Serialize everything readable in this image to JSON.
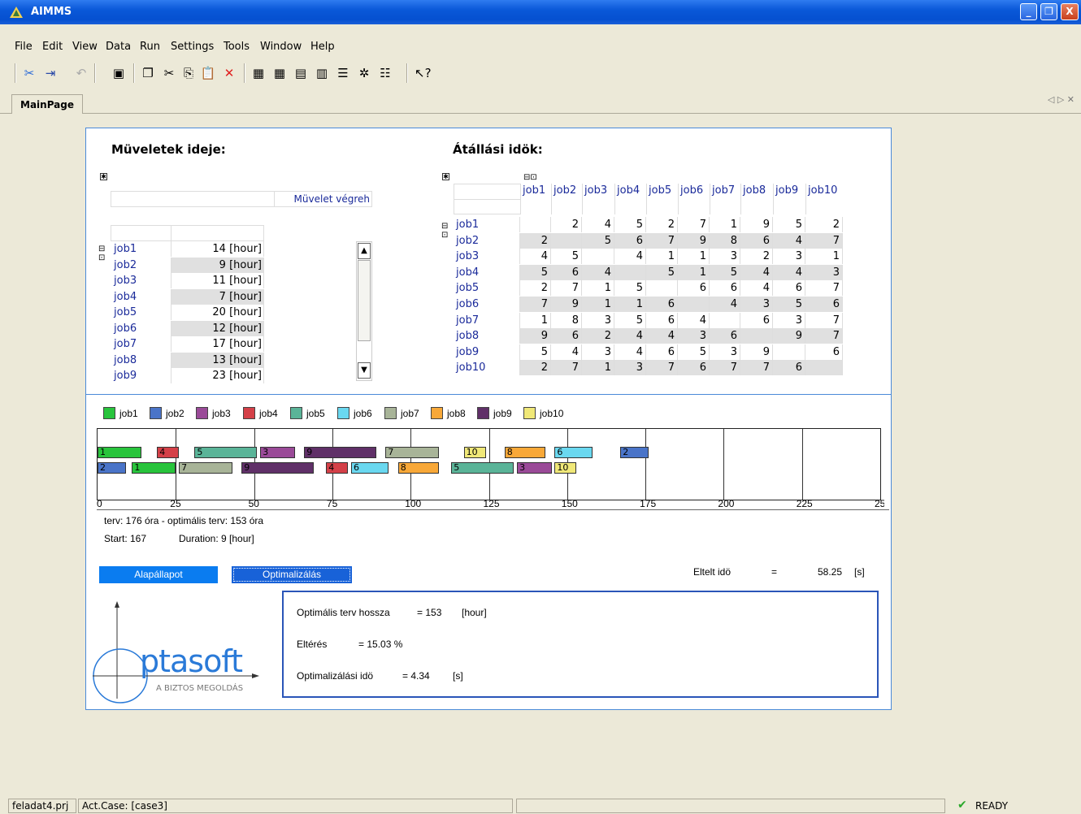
{
  "window": {
    "title": "AIMMS"
  },
  "menu": [
    "File",
    "Edit",
    "View",
    "Data",
    "Run",
    "Settings",
    "Tools",
    "Window",
    "Help"
  ],
  "tabs": {
    "main": "MainPage"
  },
  "section1": {
    "title": "Müveletek ideje:",
    "column_header": "Müvelet végreh",
    "rows": [
      {
        "job": "job1",
        "value": "14 [hour]"
      },
      {
        "job": "job2",
        "value": "9 [hour]"
      },
      {
        "job": "job3",
        "value": "11 [hour]"
      },
      {
        "job": "job4",
        "value": "7 [hour]"
      },
      {
        "job": "job5",
        "value": "20 [hour]"
      },
      {
        "job": "job6",
        "value": "12 [hour]"
      },
      {
        "job": "job7",
        "value": "17 [hour]"
      },
      {
        "job": "job8",
        "value": "13 [hour]"
      },
      {
        "job": "job9",
        "value": "23 [hour]"
      }
    ]
  },
  "section2": {
    "title": "Átállási idök:",
    "columns": [
      "job1",
      "job2",
      "job3",
      "job4",
      "job5",
      "job6",
      "job7",
      "job8",
      "job9",
      "job10"
    ],
    "rows": [
      {
        "job": "job1",
        "values": [
          "",
          "2",
          "4",
          "5",
          "2",
          "7",
          "1",
          "9",
          "5",
          "2"
        ]
      },
      {
        "job": "job2",
        "values": [
          "2",
          "",
          "5",
          "6",
          "7",
          "9",
          "8",
          "6",
          "4",
          "7"
        ]
      },
      {
        "job": "job3",
        "values": [
          "4",
          "5",
          "",
          "4",
          "1",
          "1",
          "3",
          "2",
          "3",
          "1"
        ]
      },
      {
        "job": "job4",
        "values": [
          "5",
          "6",
          "4",
          "",
          "5",
          "1",
          "5",
          "4",
          "4",
          "3"
        ]
      },
      {
        "job": "job5",
        "values": [
          "2",
          "7",
          "1",
          "5",
          "",
          "6",
          "6",
          "4",
          "6",
          "7"
        ]
      },
      {
        "job": "job6",
        "values": [
          "7",
          "9",
          "1",
          "1",
          "6",
          "",
          "4",
          "3",
          "5",
          "6"
        ]
      },
      {
        "job": "job7",
        "values": [
          "1",
          "8",
          "3",
          "5",
          "6",
          "4",
          "",
          "6",
          "3",
          "7"
        ]
      },
      {
        "job": "job8",
        "values": [
          "9",
          "6",
          "2",
          "4",
          "4",
          "3",
          "6",
          "",
          "9",
          "7"
        ]
      },
      {
        "job": "job9",
        "values": [
          "5",
          "4",
          "3",
          "4",
          "6",
          "5",
          "3",
          "9",
          "",
          "6"
        ]
      },
      {
        "job": "job10",
        "values": [
          "2",
          "7",
          "1",
          "3",
          "7",
          "6",
          "7",
          "7",
          "6",
          ""
        ]
      }
    ]
  },
  "gantt": {
    "legend": [
      {
        "name": "job1",
        "color": "#28c43c"
      },
      {
        "name": "job2",
        "color": "#4a74c8"
      },
      {
        "name": "job3",
        "color": "#9a4a98"
      },
      {
        "name": "job4",
        "color": "#d44048"
      },
      {
        "name": "job5",
        "color": "#5ab498"
      },
      {
        "name": "job6",
        "color": "#6ad8f0"
      },
      {
        "name": "job7",
        "color": "#a8b498"
      },
      {
        "name": "job8",
        "color": "#f8a838"
      },
      {
        "name": "job9",
        "color": "#603068"
      },
      {
        "name": "job10",
        "color": "#f0e878"
      }
    ],
    "axis": {
      "min": 0,
      "max": 250,
      "ticks": [
        "0",
        "25",
        "50",
        "75",
        "100",
        "125",
        "150",
        "175",
        "200",
        "225",
        "250"
      ]
    },
    "machine1": [
      {
        "label": "1",
        "job": 1,
        "start": 0,
        "end": 14
      },
      {
        "label": "4",
        "job": 4,
        "start": 19,
        "end": 26
      },
      {
        "label": "5",
        "job": 5,
        "start": 31,
        "end": 51
      },
      {
        "label": "3",
        "job": 3,
        "start": 52,
        "end": 63
      },
      {
        "label": "9",
        "job": 9,
        "start": 66,
        "end": 89
      },
      {
        "label": "7",
        "job": 7,
        "start": 92,
        "end": 109
      },
      {
        "label": "10",
        "job": 10,
        "start": 117,
        "end": 124
      },
      {
        "label": "8",
        "job": 8,
        "start": 130,
        "end": 143
      },
      {
        "label": "6",
        "job": 6,
        "start": 146,
        "end": 158
      },
      {
        "label": "2",
        "job": 2,
        "start": 167,
        "end": 176
      }
    ],
    "machine2": [
      {
        "label": "2",
        "job": 2,
        "start": 0,
        "end": 9
      },
      {
        "label": "1",
        "job": 1,
        "start": 11,
        "end": 25
      },
      {
        "label": "7",
        "job": 7,
        "start": 26,
        "end": 43
      },
      {
        "label": "9",
        "job": 9,
        "start": 46,
        "end": 69
      },
      {
        "label": "4",
        "job": 4,
        "start": 73,
        "end": 80
      },
      {
        "label": "6",
        "job": 6,
        "start": 81,
        "end": 93
      },
      {
        "label": "8",
        "job": 8,
        "start": 96,
        "end": 109
      },
      {
        "label": "5",
        "job": 5,
        "start": 113,
        "end": 133
      },
      {
        "label": "3",
        "job": 3,
        "start": 134,
        "end": 145
      },
      {
        "label": "10",
        "job": 10,
        "start": 146,
        "end": 153
      }
    ]
  },
  "info": {
    "plan": "terv: 176 óra  -  optimális terv: 153 óra",
    "start": "Start: 167",
    "duration": "Duration: 9 [hour]"
  },
  "buttons": {
    "reset": "Alapállapot",
    "optimize": "Optimalizálás"
  },
  "elapsed": {
    "label": "Eltelt idö",
    "eq": "=",
    "value": "58.25",
    "unit": "[s]"
  },
  "results": {
    "length_label": "Optimális terv hossza",
    "length_eq": "= 153",
    "length_unit": "[hour]",
    "dev_label": "Eltérés",
    "dev_value": "= 15.03 %",
    "time_label": "Optimalizálási idö",
    "time_eq": "= 4.34",
    "time_unit": "[s]"
  },
  "logo": {
    "text": "ptasoft",
    "tagline": "A BIZTOS MEGOLDÁS"
  },
  "status": {
    "project": "feladat4.prj",
    "case": "Act.Case: [case3]",
    "state": "READY"
  }
}
